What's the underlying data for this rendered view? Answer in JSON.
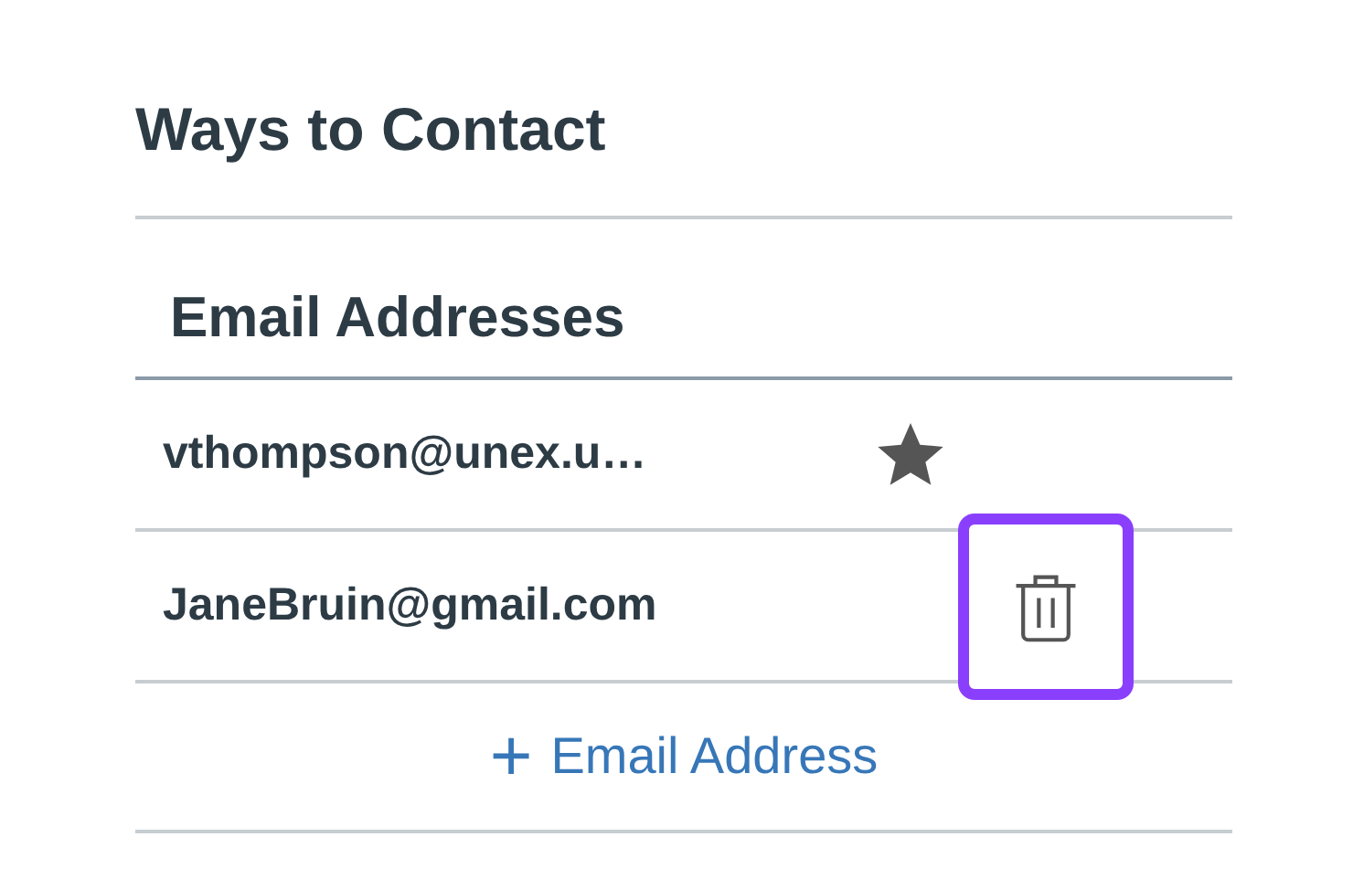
{
  "section": {
    "title": "Ways to Contact"
  },
  "email_addresses": {
    "heading": "Email Addresses",
    "rows": [
      {
        "email": "vthompson@unex.u…",
        "default": true
      },
      {
        "email": "JaneBruin@gmail.com",
        "default": false,
        "focused": true
      }
    ],
    "add_link": {
      "icon": "+",
      "label": "Email Address"
    }
  }
}
